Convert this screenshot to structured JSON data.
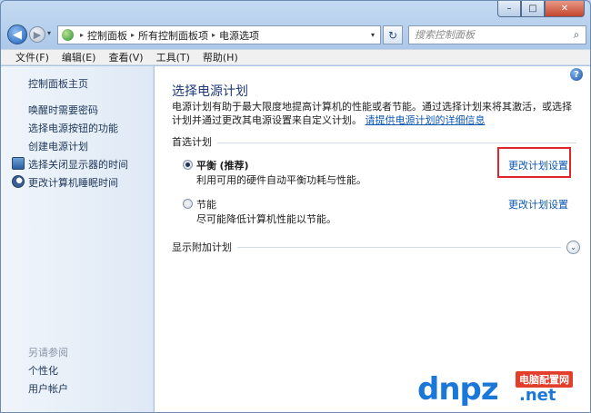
{
  "window": {
    "caption_min": "–",
    "caption_max": "□",
    "caption_close": "✕"
  },
  "nav": {
    "back_glyph": "◀",
    "forward_glyph": "▶",
    "history_glyph": "▾",
    "breadcrumbs": [
      "控制面板",
      "所有控制面板项",
      "电源选项"
    ],
    "breadcrumb_sep": "▸",
    "address_dropdown": "▾",
    "refresh_glyph": "↻",
    "search_placeholder": "搜索控制面板",
    "search_glyph": "⌕"
  },
  "menu": {
    "items": [
      "文件(F)",
      "编辑(E)",
      "查看(V)",
      "工具(T)",
      "帮助(H)"
    ]
  },
  "sidebar": {
    "home": "控制面板主页",
    "links": [
      "唤醒时需要密码",
      "选择电源按钮的功能",
      "创建电源计划",
      "选择关闭显示器的时间",
      "更改计算机睡眠时间"
    ],
    "see_also": "另请参阅",
    "see_also_links": [
      "个性化",
      "用户帐户"
    ]
  },
  "main": {
    "help_glyph": "?",
    "title": "选择电源计划",
    "description": "电源计划有助于最大限度地提高计算机的性能或者节能。通过选择计划来将其激活，或选择计划并通过更改其电源设置来自定义计划。",
    "description_link": "请提供电源计划的详细信息",
    "preferred_section": "首选计划",
    "plans": [
      {
        "name": "平衡",
        "tag": "(推荐)",
        "desc": "利用可用的硬件自动平衡功耗与性能。",
        "link": "更改计划设置",
        "selected": true
      },
      {
        "name": "节能",
        "tag": "",
        "desc": "尽可能降低计算机性能以节能。",
        "link": "更改计划设置",
        "selected": false
      }
    ],
    "more_plans": "显示附加计划",
    "expand_glyph": "⌄"
  },
  "watermark": {
    "main": "dnpz",
    "badge": "电脑配置网",
    "net": ".net"
  },
  "colors": {
    "link": "#0b57b4",
    "title": "#1e3a78",
    "highlight": "#e0262a"
  }
}
